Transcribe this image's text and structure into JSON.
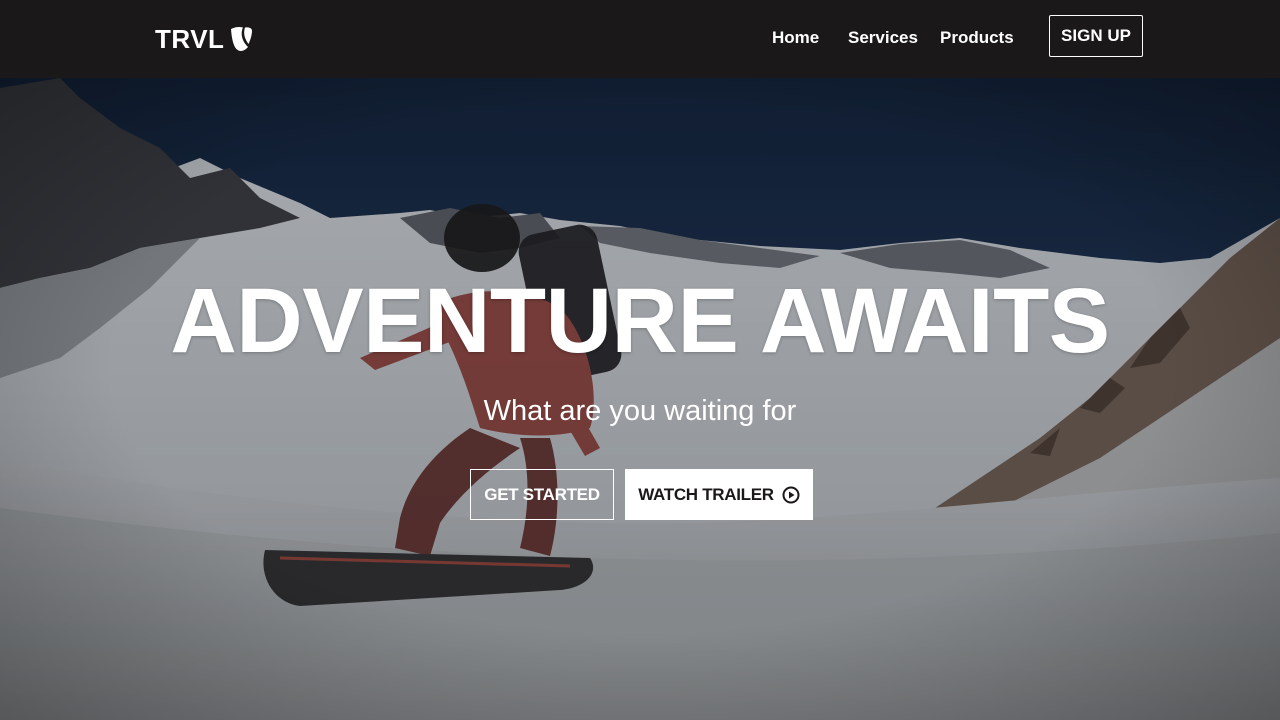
{
  "colors": {
    "navbar_bg": "#1a1818",
    "text": "#ffffff",
    "button_fill": "#ffffff",
    "button_text": "#1a1818"
  },
  "navbar": {
    "logo_text": "TRVL",
    "logo_icon": "typo3-logo-icon",
    "links": [
      {
        "label": "Home"
      },
      {
        "label": "Services"
      },
      {
        "label": "Products"
      }
    ],
    "signup_label": "SIGN UP"
  },
  "hero": {
    "background": "snowboarder-mountain-photo",
    "title": "ADVENTURE AWAITS",
    "subtitle": "What are you waiting for",
    "primary_button": "GET STARTED",
    "secondary_button": "WATCH TRAILER",
    "secondary_button_icon": "play-circle-icon"
  }
}
